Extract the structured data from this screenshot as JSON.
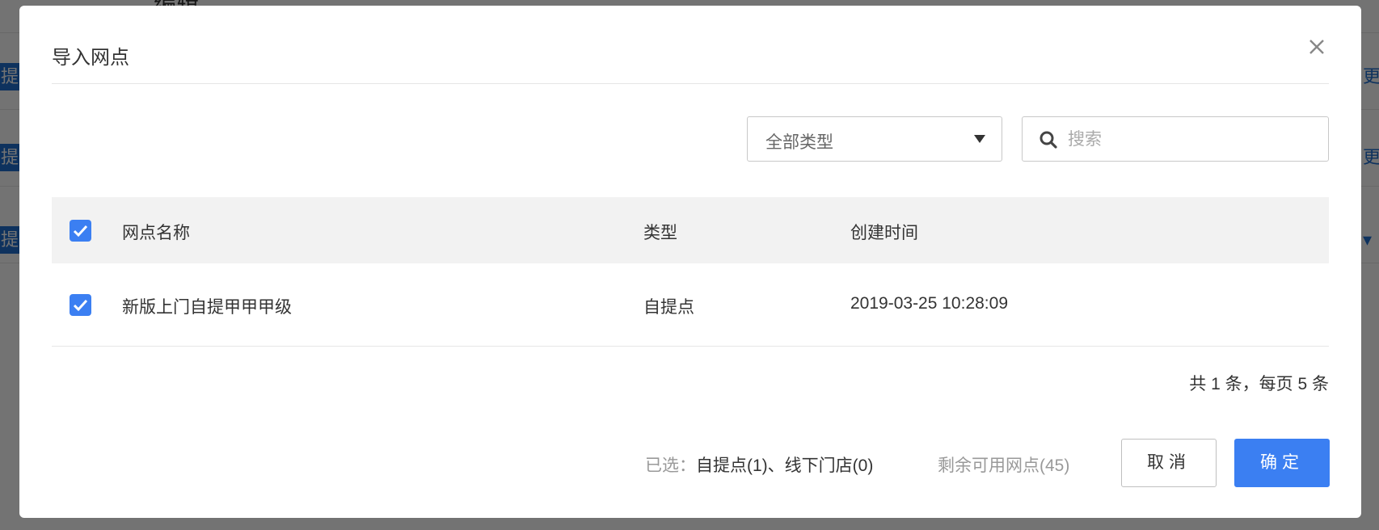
{
  "background": {
    "top_text": "编辑",
    "tags": [
      "提",
      "提",
      "提"
    ],
    "right_text": [
      "更多",
      "更多",
      "▾"
    ]
  },
  "dialog": {
    "title": "导入网点",
    "type_filter": {
      "value": "全部类型"
    },
    "search": {
      "placeholder": "搜索",
      "value": ""
    },
    "table": {
      "columns": [
        "网点名称",
        "类型",
        "创建时间"
      ],
      "header_checked": true,
      "rows": [
        {
          "checked": true,
          "name": "新版上门自提甲甲甲级",
          "type": "自提点",
          "created": "2019-03-25 10:28:09"
        }
      ]
    },
    "pagination": "共 1 条，每页 5 条",
    "footer": {
      "selected_label": "已选：",
      "selected_value": "自提点(1)、线下门店(0)",
      "remaining": "剩余可用网点(45)",
      "cancel_label": "取消",
      "confirm_label": "确定"
    }
  },
  "colors": {
    "primary": "#3b7ff2",
    "overlay": "#6e6e6e",
    "header_bg": "#f2f2f2"
  }
}
